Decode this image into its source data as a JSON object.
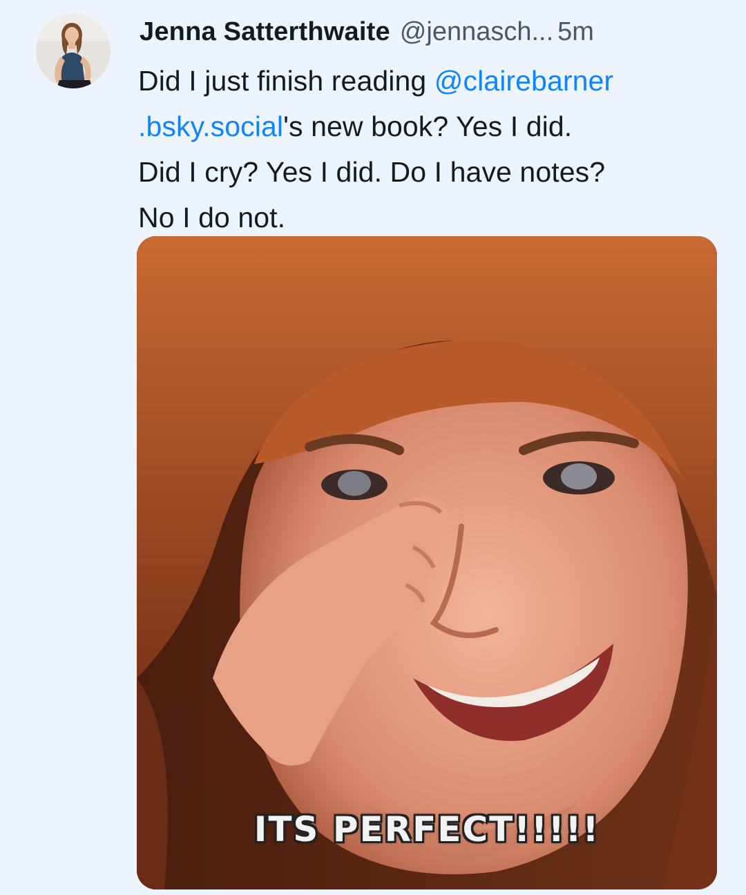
{
  "post": {
    "author": {
      "display_name": "Jenna Satterthwaite",
      "handle": "@jennasch...",
      "timestamp": "5m"
    },
    "text": {
      "line1_before": "Did I just finish reading ",
      "line1_mention": "@clairebarner",
      "line2_mention": ".bsky.social",
      "line2_after": "'s new book? Yes I did.",
      "line3": "Did I cry? Yes I did. Do I have notes?",
      "line4": "No I do not."
    },
    "media": {
      "caption": "ITS PERFECT!!!!!"
    }
  },
  "colors": {
    "background": "#eef4fd",
    "text": "#141a22",
    "secondary_text": "#46586b",
    "mention": "#1083fe"
  }
}
